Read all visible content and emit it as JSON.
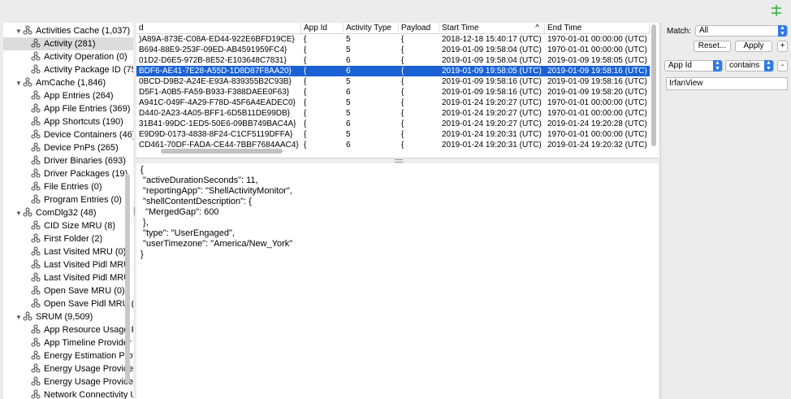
{
  "tree": [
    {
      "label": "Activities Cache (1,037)",
      "level": 0,
      "expanded": true,
      "selected": false
    },
    {
      "label": "Activity (281)",
      "level": 1,
      "selected": true
    },
    {
      "label": "Activity Operation (0)",
      "level": 1
    },
    {
      "label": "Activity Package ID (75",
      "level": 1
    },
    {
      "label": "AmCache (1,846)",
      "level": 0,
      "expanded": true
    },
    {
      "label": "App Entries (264)",
      "level": 1
    },
    {
      "label": "App File Entries (369)",
      "level": 1
    },
    {
      "label": "App Shortcuts (190)",
      "level": 1
    },
    {
      "label": "Device Containers (46)",
      "level": 1
    },
    {
      "label": "Device PnPs (265)",
      "level": 1
    },
    {
      "label": "Driver Binaries (693)",
      "level": 1
    },
    {
      "label": "Driver Packages (19)",
      "level": 1
    },
    {
      "label": "File Entries (0)",
      "level": 1
    },
    {
      "label": "Program Entries (0)",
      "level": 1
    },
    {
      "label": "ComDlg32 (48)",
      "level": 0,
      "expanded": true
    },
    {
      "label": "CID Size MRU (8)",
      "level": 1
    },
    {
      "label": "First Folder (2)",
      "level": 1
    },
    {
      "label": "Last Visited MRU (0)",
      "level": 1
    },
    {
      "label": "Last Visited Pidl MRU (",
      "level": 1
    },
    {
      "label": "Last Visited Pidl MRU L",
      "level": 1
    },
    {
      "label": "Open Save MRU (0)",
      "level": 1
    },
    {
      "label": "Open Save Pidl MRU (2",
      "level": 1
    },
    {
      "label": "SRUM (9,509)",
      "level": 0,
      "expanded": true
    },
    {
      "label": "App Resource Usage P",
      "level": 1
    },
    {
      "label": "App Timeline Provider (",
      "level": 1
    },
    {
      "label": "Energy Estimation Prov",
      "level": 1
    },
    {
      "label": "Energy Usage Provider",
      "level": 1
    },
    {
      "label": "Energy Usage Provider",
      "level": 1
    },
    {
      "label": "Network Connectivity U",
      "level": 1
    }
  ],
  "table": {
    "columns": [
      "d",
      "App Id",
      "Activity Type",
      "Payload",
      "Start Time",
      "End Time"
    ],
    "sort_indicator": "^",
    "rows": [
      {
        "id": ")A89A-873E-C08A-ED44-922E6BFD19CE}",
        "app": "{",
        "type": "5",
        "payload": "{",
        "start": "2018-12-18 15:40:17 (UTC)",
        "end": "1970-01-01 00:00:00 (UTC)"
      },
      {
        "id": "B694-88E9-253F-09ED-AB4591959FC4}",
        "app": "{",
        "type": "5",
        "payload": "{",
        "start": "2019-01-09 19:58:04 (UTC)",
        "end": "1970-01-01 00:00:00 (UTC)"
      },
      {
        "id": "01D2-D6E5-972B-8E52-E103648C7831}",
        "app": "{",
        "type": "6",
        "payload": "{",
        "start": "2019-01-09 19:58:04 (UTC)",
        "end": "2019-01-09 19:58:05 (UTC)"
      },
      {
        "id": "BDF6-AE41-7E28-A55D-1D8D87F8AA20}",
        "app": "{",
        "type": "6",
        "payload": "{",
        "start": "2019-01-09 19:58:05 (UTC)",
        "end": "2019-01-09 19:58:16 (UTC)",
        "selected": true
      },
      {
        "id": "0BCD-D9B2-A24E-E93A-839355B2C93B}",
        "app": "{",
        "type": "5",
        "payload": "{",
        "start": "2019-01-09 19:58:16 (UTC)",
        "end": "2019-01-09 19:58:16 (UTC)"
      },
      {
        "id": "D5F1-A0B5-FA59-B933-F388DAEE0F63}",
        "app": "{",
        "type": "6",
        "payload": "{",
        "start": "2019-01-09 19:58:16 (UTC)",
        "end": "2019-01-09 19:58:20 (UTC)"
      },
      {
        "id": "A941C-049F-4A29-F78D-45F6A4EADEC0}",
        "app": "{",
        "type": "5",
        "payload": "{",
        "start": "2019-01-24 19:20:27 (UTC)",
        "end": "1970-01-01 00:00:00 (UTC)"
      },
      {
        "id": "D440-2A23-4A05-BFF1-6D5B11DE99DB}",
        "app": "{",
        "type": "5",
        "payload": "{",
        "start": "2019-01-24 19:20:27 (UTC)",
        "end": "1970-01-01 00:00:00 (UTC)"
      },
      {
        "id": "31B41-99DC-1ED5-50E6-09BB749BAC4A}",
        "app": "{",
        "type": "6",
        "payload": "{",
        "start": "2019-01-24 19:20:27 (UTC)",
        "end": "2019-01-24 19:20:28 (UTC)"
      },
      {
        "id": "E9D9D-0173-4838-8F24-C1CF5119DFFA}",
        "app": "{",
        "type": "5",
        "payload": "{",
        "start": "2019-01-24 19:20:31 (UTC)",
        "end": "1970-01-01 00:00:00 (UTC)"
      },
      {
        "id": "CD461-70DF-FADA-CE44-7BBF7684AAC4}",
        "app": "{",
        "type": "6",
        "payload": "{",
        "start": "2019-01-24 19:20:31 (UTC)",
        "end": "2019-01-24 19:20:32 (UTC)"
      }
    ]
  },
  "json_view": [
    "{",
    " \"activeDurationSeconds\": 11,",
    " \"reportingApp\": \"ShellActivityMonitor\",",
    " \"shellContentDescription\": {",
    "  \"MergedGap\": 600",
    " },",
    " \"type\": \"UserEngaged\",",
    " \"userTimezone\": \"America/New_York\"",
    "}"
  ],
  "filter": {
    "match_label": "Match:",
    "match_value": "All",
    "reset_label": "Reset...",
    "apply_label": "Apply",
    "add_label": "+",
    "remove_label": "-",
    "field_value": "App Id",
    "operator_value": "contains",
    "text_value": "IrfanView"
  },
  "colors": {
    "selection": "#1a62d4",
    "accent": "#2f7ae5",
    "filter_icon": "#3cb043"
  }
}
